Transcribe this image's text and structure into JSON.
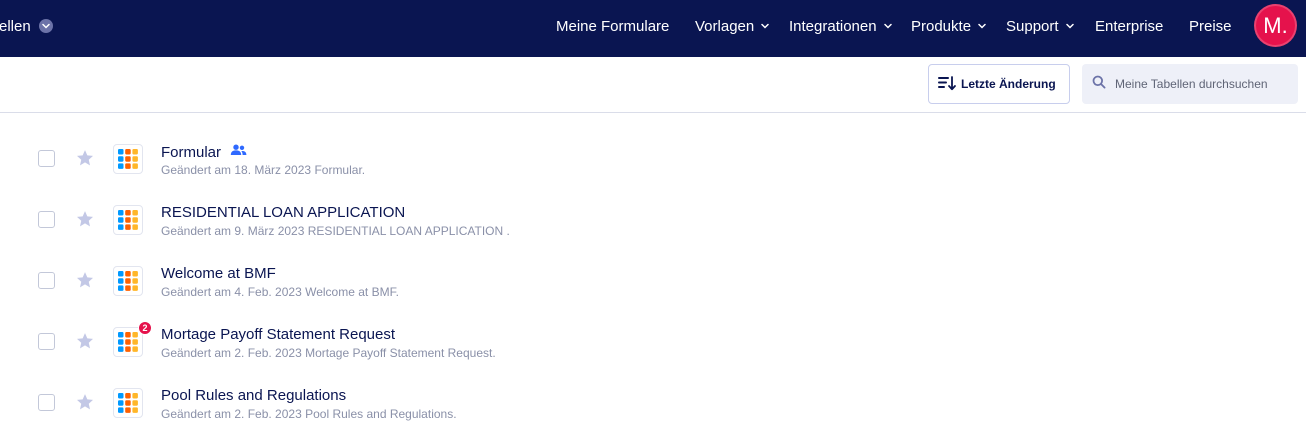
{
  "header": {
    "brand_partial": "ellen",
    "nav": [
      {
        "label": "Meine Formulare",
        "has_caret": false
      },
      {
        "label": "Vorlagen",
        "has_caret": true
      },
      {
        "label": "Integrationen",
        "has_caret": true
      },
      {
        "label": "Produkte",
        "has_caret": true
      },
      {
        "label": "Support",
        "has_caret": true
      },
      {
        "label": "Enterprise",
        "has_caret": false
      },
      {
        "label": "Preise",
        "has_caret": false
      }
    ],
    "avatar_initials": "M.",
    "colors": {
      "background": "#0a1551",
      "avatar": "#e5124c"
    }
  },
  "toolbar": {
    "sort_label": "Letzte Änderung",
    "search_placeholder": "Meine Tabellen durchsuchen"
  },
  "forms": [
    {
      "title": "Formular",
      "shared": true,
      "badge": "",
      "date_text": "Geändert am 18. März 2023",
      "detail": "Formular."
    },
    {
      "title": "RESIDENTIAL LOAN APPLICATION",
      "shared": false,
      "badge": "",
      "date_text": "Geändert am 9. März 2023",
      "detail": "RESIDENTIAL LOAN APPLICATION ."
    },
    {
      "title": "Welcome at BMF",
      "shared": false,
      "badge": "",
      "date_text": "Geändert am 4. Feb. 2023",
      "detail": "Welcome at BMF."
    },
    {
      "title": "Mortage Payoff Statement Request",
      "shared": false,
      "badge": "2",
      "date_text": "Geändert am 2. Feb. 2023",
      "detail": "Mortage Payoff Statement Request."
    },
    {
      "title": "Pool Rules and Regulations",
      "shared": false,
      "badge": "",
      "date_text": "Geändert am 2. Feb. 2023",
      "detail": "Pool Rules and Regulations."
    }
  ],
  "icons": {
    "brand_caret": "chevron-down-icon",
    "nav_caret": "chevron-down-icon",
    "sort": "sort-icon",
    "search": "search-icon",
    "star": "star-icon",
    "form": "tables-grid-icon",
    "shared": "users-icon"
  }
}
